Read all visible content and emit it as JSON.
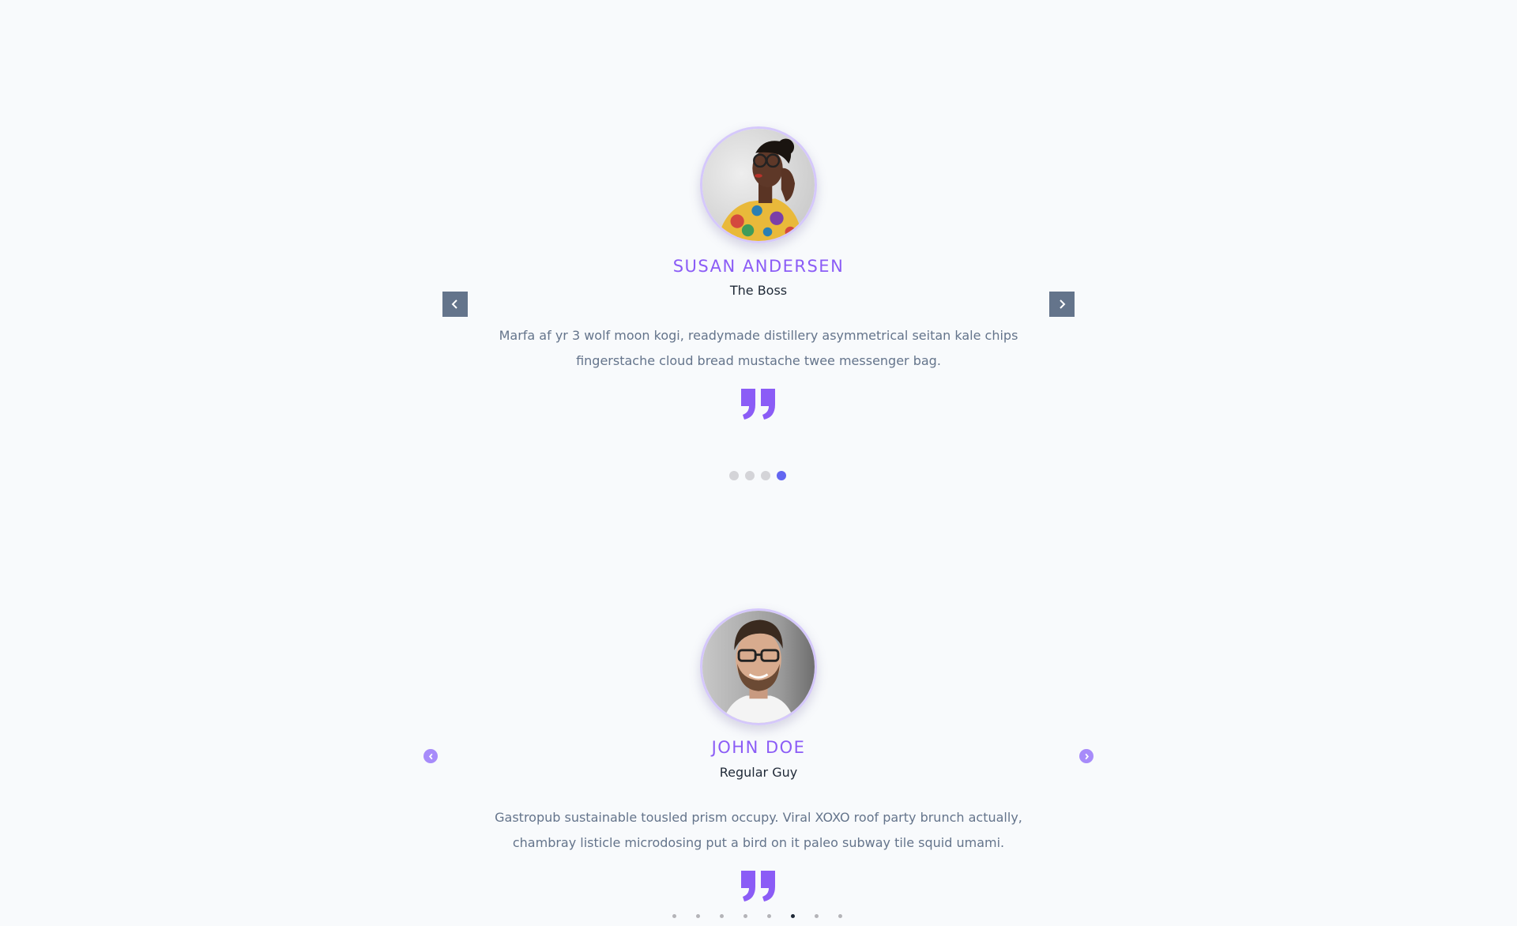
{
  "colors": {
    "background": "#f8fafc",
    "accent": "#8b5cf6",
    "arrow_square": "#64748b",
    "arrow_round": "#a78bfa",
    "dot_active_1": "#6366f1",
    "dot_active_2": "#1f2937"
  },
  "slider1": {
    "name": "SUSAN ANDERSEN",
    "role": "The Boss",
    "quote": "Marfa af yr 3 wolf moon kogi, readymade distillery asymmetrical seitan kale chips fingerstache cloud bread mustache twee messenger bag.",
    "prev_icon": "chevron-left-icon",
    "next_icon": "chevron-right-icon",
    "quote_icon": "quote-icon",
    "dots": [
      false,
      false,
      false,
      true
    ]
  },
  "slider2": {
    "name": "JOHN DOE",
    "role": "Regular Guy",
    "quote": "Gastropub sustainable tousled prism occupy. Viral XOXO roof party brunch actually, chambray listicle microdosing put a bird on it paleo subway tile squid umami.",
    "prev_icon": "chevron-circle-left-icon",
    "next_icon": "chevron-circle-right-icon",
    "quote_icon": "quote-icon",
    "dots": [
      false,
      false,
      false,
      false,
      false,
      true,
      false,
      false
    ]
  }
}
